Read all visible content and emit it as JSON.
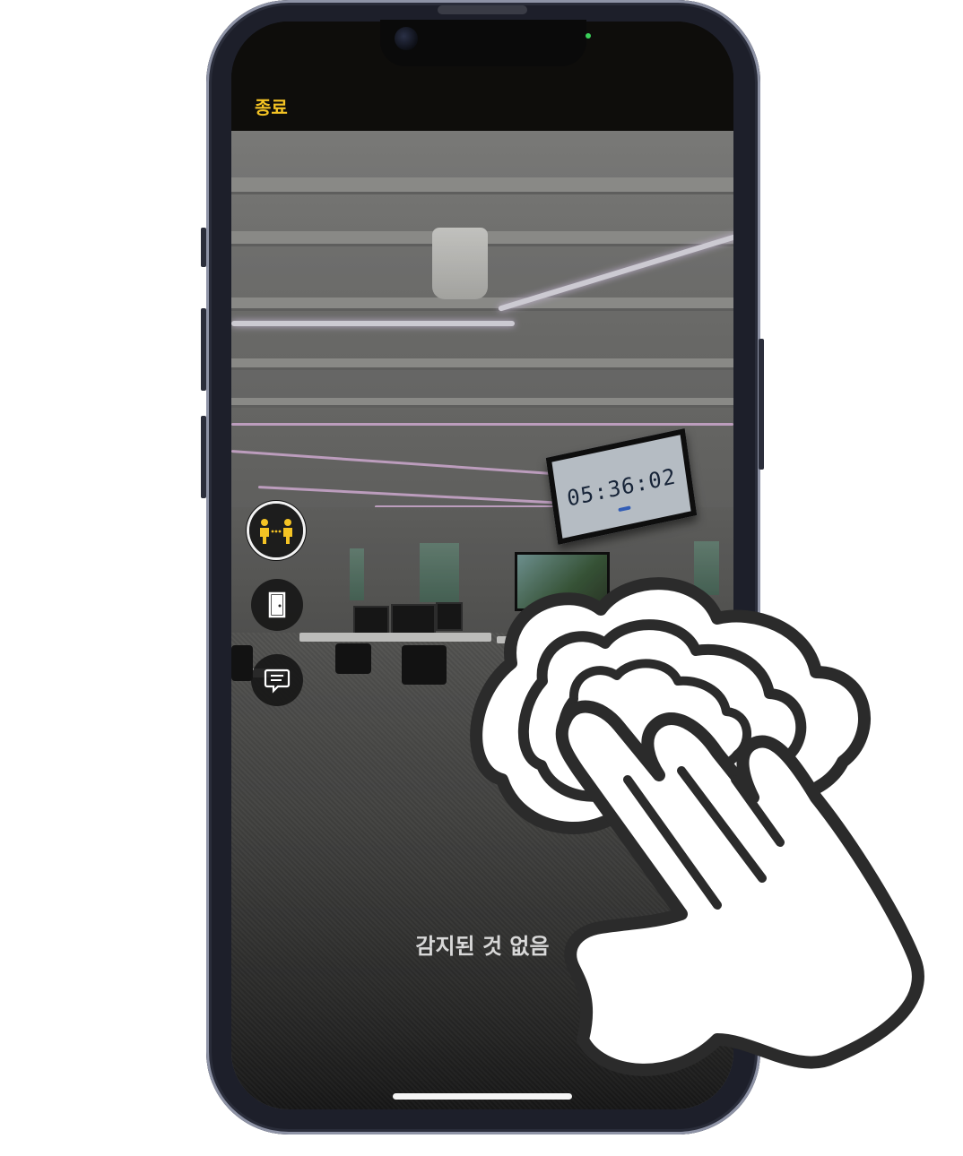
{
  "top_bar": {
    "end_label": "종료"
  },
  "camera": {
    "clock_display": "05:36:02",
    "detection_status": "감지된 것 없음"
  },
  "side_controls": [
    {
      "name": "people-detection",
      "icon": "people-distance-icon",
      "active": true
    },
    {
      "name": "door-detection",
      "icon": "door-icon",
      "active": false
    },
    {
      "name": "text-detection",
      "icon": "speech-bubble-text-icon",
      "active": false
    }
  ],
  "gesture": {
    "icon": "three-finger-double-tap-hand-icon"
  },
  "colors": {
    "accent": "#f4c324",
    "control_bg": "#141414",
    "status_text": "#d8d8d8",
    "frame": "#1d1f2a"
  }
}
